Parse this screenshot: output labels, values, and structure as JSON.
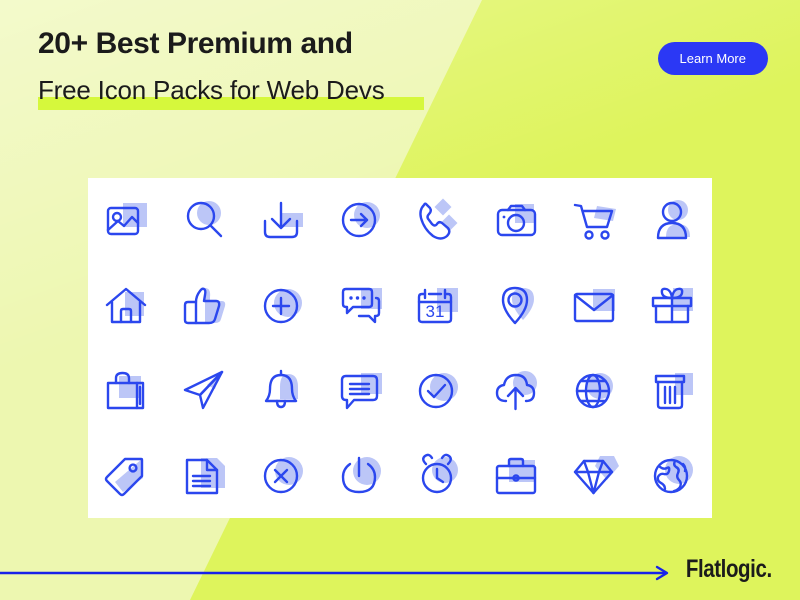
{
  "banner": {
    "headline": "20+ Best Premium and",
    "subline": "Free Icon Packs for Web Devs",
    "cta_label": "Learn More",
    "logo_text": "Flatlogic.",
    "colors": {
      "bg_light": "#EDF7B0",
      "bg_dark": "#DEF45C",
      "highlight": "#D6F83C",
      "cta_bg": "#2B38F5",
      "cta_text": "#FFFFFF",
      "icon_stroke": "#2B47EE",
      "icon_accent": "#BCC6F7",
      "card_bg": "#FFFFFF",
      "text_dark": "#1B1B1B"
    }
  },
  "icon_grid": {
    "columns": 8,
    "rows": 4,
    "calendar_day": "31",
    "icons": [
      {
        "name": "image-icon",
        "label": "Image"
      },
      {
        "name": "search-icon",
        "label": "Search"
      },
      {
        "name": "download-icon",
        "label": "Download"
      },
      {
        "name": "arrow-right-circle-icon",
        "label": "Arrow Right Circle"
      },
      {
        "name": "phone-icon",
        "label": "Phone"
      },
      {
        "name": "camera-icon",
        "label": "Camera"
      },
      {
        "name": "shopping-cart-icon",
        "label": "Shopping Cart"
      },
      {
        "name": "user-icon",
        "label": "User"
      },
      {
        "name": "home-icon",
        "label": "Home"
      },
      {
        "name": "thumbs-up-icon",
        "label": "Thumbs Up"
      },
      {
        "name": "plus-circle-icon",
        "label": "Plus Circle"
      },
      {
        "name": "chat-bubbles-icon",
        "label": "Chat Bubbles"
      },
      {
        "name": "calendar-icon",
        "label": "Calendar"
      },
      {
        "name": "location-pin-icon",
        "label": "Location Pin"
      },
      {
        "name": "envelope-icon",
        "label": "Envelope"
      },
      {
        "name": "gift-icon",
        "label": "Gift"
      },
      {
        "name": "shopping-bag-icon",
        "label": "Shopping Bag"
      },
      {
        "name": "send-icon",
        "label": "Send"
      },
      {
        "name": "bell-icon",
        "label": "Bell"
      },
      {
        "name": "message-lines-icon",
        "label": "Message"
      },
      {
        "name": "check-circle-icon",
        "label": "Check Circle"
      },
      {
        "name": "cloud-upload-icon",
        "label": "Cloud Upload"
      },
      {
        "name": "globe-grid-icon",
        "label": "Globe"
      },
      {
        "name": "trash-icon",
        "label": "Trash"
      },
      {
        "name": "tag-icon",
        "label": "Tag"
      },
      {
        "name": "document-icon",
        "label": "Document"
      },
      {
        "name": "close-circle-icon",
        "label": "Close Circle"
      },
      {
        "name": "power-icon",
        "label": "Power"
      },
      {
        "name": "alarm-clock-icon",
        "label": "Alarm Clock"
      },
      {
        "name": "briefcase-icon",
        "label": "Briefcase"
      },
      {
        "name": "diamond-icon",
        "label": "Diamond"
      },
      {
        "name": "earth-icon",
        "label": "Earth"
      }
    ]
  }
}
